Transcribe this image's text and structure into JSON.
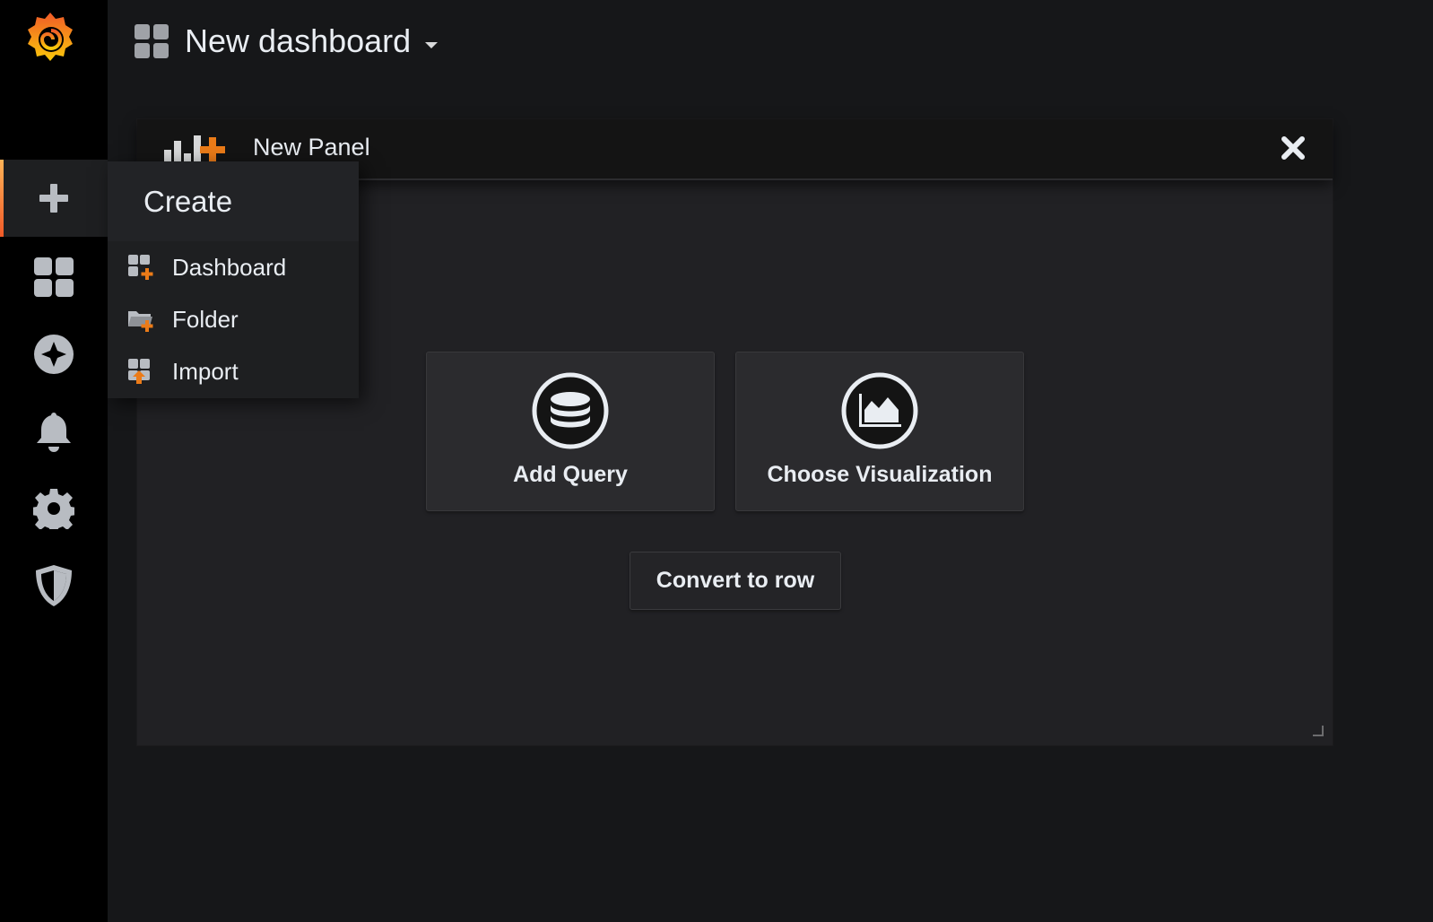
{
  "header": {
    "title": "New dashboard"
  },
  "panel": {
    "title": "New Panel",
    "actions": [
      {
        "label": "Add Query",
        "icon": "database-icon"
      },
      {
        "label": "Choose Visualization",
        "icon": "area-chart-icon"
      }
    ],
    "convert_label": "Convert to row"
  },
  "create_menu": {
    "title": "Create",
    "items": [
      {
        "label": "Dashboard",
        "icon": "dashboard-add-icon"
      },
      {
        "label": "Folder",
        "icon": "folder-add-icon"
      },
      {
        "label": "Import",
        "icon": "import-icon"
      }
    ]
  },
  "colors": {
    "accent": "#f05a28",
    "accent_light": "#ffb357",
    "background": "#161719",
    "sidebar": "#000000"
  }
}
